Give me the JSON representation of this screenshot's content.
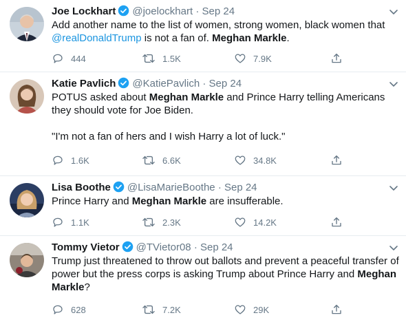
{
  "tweets": [
    {
      "name": "Joe Lockhart",
      "handle": "@joelockhart",
      "dot": "·",
      "date": "Sep 24",
      "text_parts": [
        {
          "t": "Add another name to the list of women, strong women, black women that "
        },
        {
          "t": "@realDonaldTrump",
          "mention": true
        },
        {
          "t": " is not a fan of.  "
        },
        {
          "t": "Meghan Markle",
          "bold": true
        },
        {
          "t": "."
        }
      ],
      "replies": "444",
      "retweets": "1.5K",
      "likes": "7.9K"
    },
    {
      "name": "Katie Pavlich",
      "handle": "@KatiePavlich",
      "dot": "·",
      "date": "Sep 24",
      "text_parts": [
        {
          "t": "POTUS asked about "
        },
        {
          "t": "Meghan Markle",
          "bold": true
        },
        {
          "t": " and Prince Harry telling Americans they should vote for Joe Biden."
        },
        {
          "br": true
        },
        {
          "t": "\"I'm not a fan of hers and I wish Harry a lot of luck.\""
        }
      ],
      "replies": "1.6K",
      "retweets": "6.6K",
      "likes": "34.8K"
    },
    {
      "name": "Lisa Boothe",
      "handle": "@LisaMarieBoothe",
      "dot": "·",
      "date": "Sep 24",
      "text_parts": [
        {
          "t": "Prince Harry and "
        },
        {
          "t": "Meghan Markle",
          "bold": true
        },
        {
          "t": " are insufferable."
        }
      ],
      "replies": "1.1K",
      "retweets": "2.3K",
      "likes": "14.2K"
    },
    {
      "name": "Tommy Vietor",
      "handle": "@TVietor08",
      "dot": "·",
      "date": "Sep 24",
      "text_parts": [
        {
          "t": "Trump just threatened to throw out ballots and prevent a peaceful transfer of power but the press corps is asking Trump about Prince Harry and "
        },
        {
          "t": "Meghan Markle",
          "bold": true
        },
        {
          "t": "?"
        }
      ],
      "replies": "628",
      "retweets": "7.2K",
      "likes": "29K"
    }
  ],
  "icons": {
    "reply": "reply-icon",
    "retweet": "retweet-icon",
    "like": "heart-icon",
    "share": "share-icon",
    "verified": "verified-badge-icon",
    "caret": "chevron-down-icon"
  },
  "colors": {
    "text": "#14171a",
    "muted": "#657786",
    "link": "#1b95e0",
    "verified": "#1da1f2",
    "divider": "#e6ecf0"
  }
}
